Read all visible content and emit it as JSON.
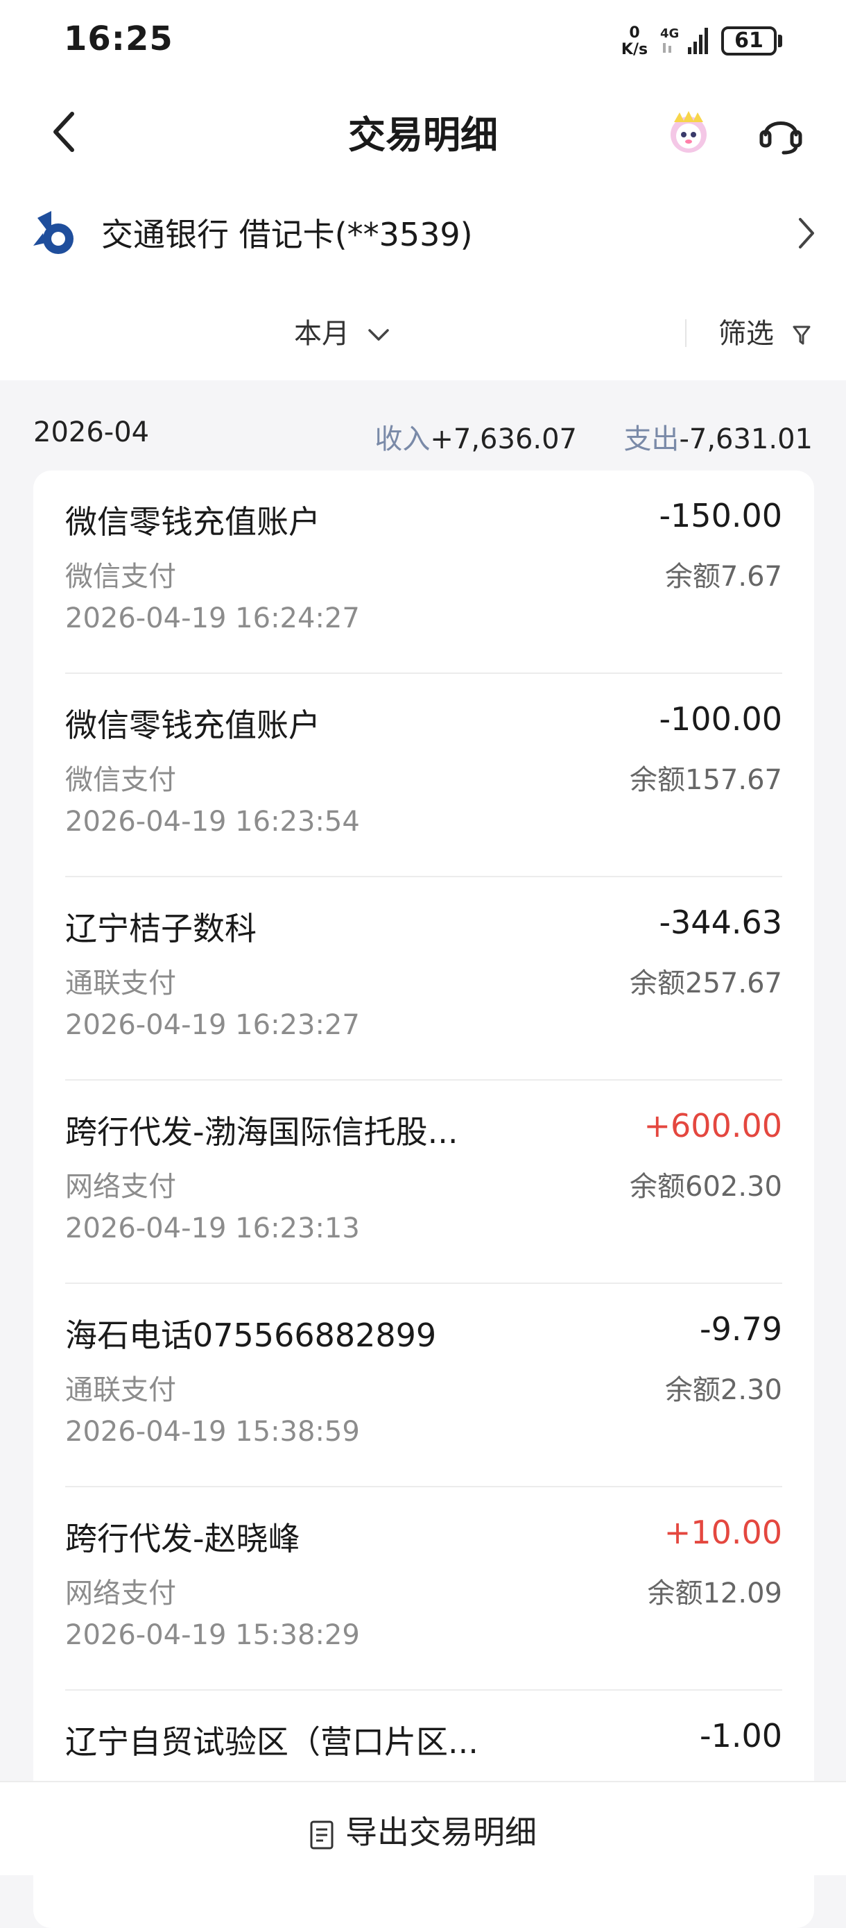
{
  "status_bar": {
    "time": "16:25",
    "net_speed_value": "0",
    "net_speed_unit": "K/s",
    "network": "4G",
    "battery": "61"
  },
  "header": {
    "title": "交易明细",
    "icons": [
      "back-arrow-icon",
      "mascot-icon",
      "customer-service-icon"
    ]
  },
  "account": {
    "name": "交通银行 借记卡(**3539)",
    "logo_color": "#1f4e9c"
  },
  "filters": {
    "period": "本月",
    "filter": "筛选"
  },
  "summary": {
    "month": "2026-04",
    "income_label": "收入",
    "income_value": "+7,636.07",
    "expense_label": "支出",
    "expense_value": "-7,631.01"
  },
  "colors": {
    "positive": "#e4473f",
    "muted_label": "#7a8aa8"
  },
  "transactions": [
    {
      "name": "微信零钱充值账户",
      "amount": "-150.00",
      "channel": "微信支付",
      "balance": "余额7.67",
      "time": "2026-04-19 16:24:27",
      "positive": false
    },
    {
      "name": "微信零钱充值账户",
      "amount": "-100.00",
      "channel": "微信支付",
      "balance": "余额157.67",
      "time": "2026-04-19 16:23:54",
      "positive": false
    },
    {
      "name": "辽宁桔子数科",
      "amount": "-344.63",
      "channel": "通联支付",
      "balance": "余额257.67",
      "time": "2026-04-19 16:23:27",
      "positive": false
    },
    {
      "name": "跨行代发-渤海国际信托股...",
      "amount": "+600.00",
      "channel": "网络支付",
      "balance": "余额602.30",
      "time": "2026-04-19 16:23:13",
      "positive": true
    },
    {
      "name": "海石电话075566882899",
      "amount": "-9.79",
      "channel": "通联支付",
      "balance": "余额2.30",
      "time": "2026-04-19 15:38:59",
      "positive": false
    },
    {
      "name": "跨行代发-赵晓峰",
      "amount": "+10.00",
      "channel": "网络支付",
      "balance": "余额12.09",
      "time": "2026-04-19 15:38:29",
      "positive": true
    },
    {
      "name": "辽宁自贸试验区（营口片区...",
      "amount": "-1.00",
      "channel": "",
      "balance": "",
      "time": "",
      "positive": false
    }
  ],
  "bottom": {
    "export_label": "导出交易明细"
  }
}
